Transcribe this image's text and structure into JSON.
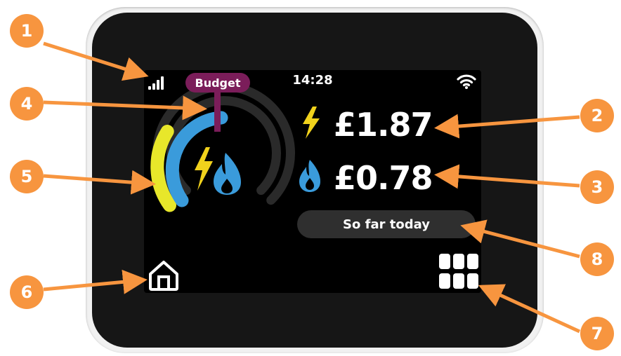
{
  "status_bar": {
    "time": "14:28",
    "signal_icon": "signal-bars-icon",
    "wifi_icon": "wifi-icon"
  },
  "gauge": {
    "budget_label": "Budget",
    "electricity_icon": "lightning-bolt-icon",
    "gas_icon": "gas-flame-icon",
    "colors": {
      "electricity": "#e8e72a",
      "gas": "#3a9bdb",
      "track": "#2a2a2a",
      "budget": "#7b1d5a"
    }
  },
  "costs": {
    "electricity": {
      "icon": "lightning-bolt-icon",
      "amount": "£1.87",
      "color": "#f1d21c"
    },
    "gas": {
      "icon": "gas-flame-icon",
      "amount": "£0.78",
      "color": "#3a9bdb"
    }
  },
  "period": {
    "label": "So far today"
  },
  "nav": {
    "home_icon": "home-icon",
    "menu_icon": "grid-menu-icon"
  },
  "callouts": {
    "labels": [
      "1",
      "2",
      "3",
      "4",
      "5",
      "6",
      "7",
      "8"
    ],
    "color": "#f7953f"
  }
}
